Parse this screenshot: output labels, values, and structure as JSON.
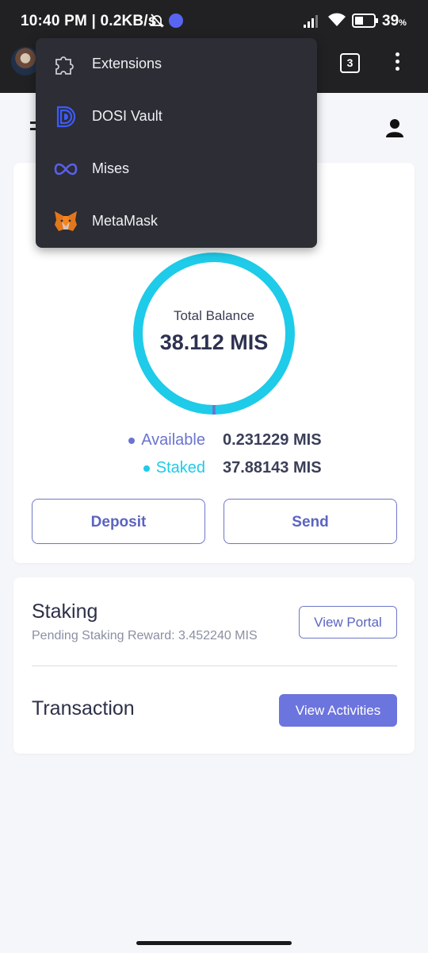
{
  "status_bar": {
    "time": "10:40 PM | 0.2KB/s",
    "battery": "39",
    "battery_unit": "%"
  },
  "browser": {
    "tab_count": "3"
  },
  "menu": {
    "items": [
      {
        "label": "Extensions",
        "icon": "puzzle-icon"
      },
      {
        "label": "DOSI Vault",
        "icon": "dosi-vault-icon"
      },
      {
        "label": "Mises",
        "icon": "mises-icon"
      },
      {
        "label": "MetaMask",
        "icon": "metamask-fox-icon"
      }
    ]
  },
  "balance": {
    "label": "Total Balance",
    "value": "38.112 MIS",
    "available_label": "Available",
    "available_value": "0.231229 MIS",
    "staked_label": "Staked",
    "staked_value": "37.88143 MIS",
    "available_fraction": 0.0061,
    "colors": {
      "available": "#6a74d0",
      "staked": "#1ecbe8"
    }
  },
  "actions": {
    "deposit": "Deposit",
    "send": "Send"
  },
  "staking": {
    "title": "Staking",
    "reward": "Pending Staking Reward: 3.452240 MIS",
    "view_portal": "View Portal"
  },
  "transaction": {
    "title": "Transaction",
    "view_activities": "View Activities"
  },
  "colors": {
    "accent": "#6c74dd",
    "donut": "#1ecbe8",
    "chrome": "#212123",
    "menu_bg": "#2c2d35"
  }
}
